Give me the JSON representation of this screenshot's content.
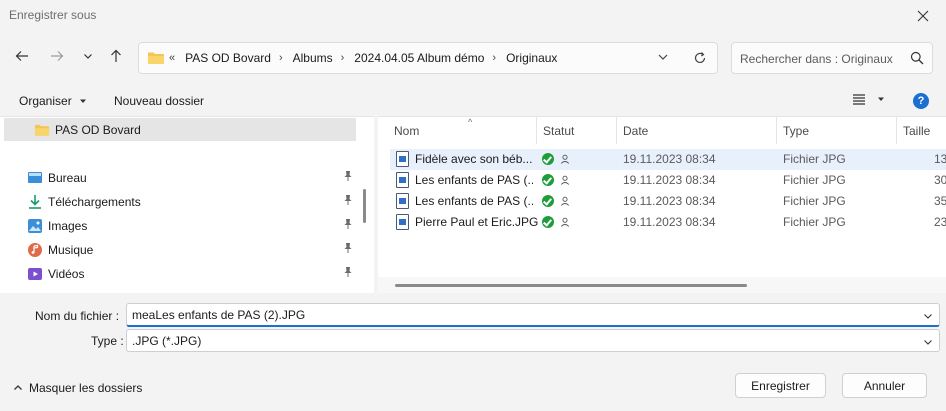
{
  "window": {
    "title": "Enregistrer sous"
  },
  "address": {
    "overflow": "«",
    "segments": [
      "PAS OD Bovard",
      "Albums",
      "2024.04.05 Album démo",
      "Originaux"
    ]
  },
  "search": {
    "placeholder": "Rechercher dans : Originaux"
  },
  "toolbar": {
    "organize_label": "Organiser",
    "new_folder_label": "Nouveau dossier",
    "help_label": "?"
  },
  "nav_pane": {
    "selected_label": "PAS OD Bovard",
    "items": [
      {
        "label": "Bureau",
        "icon": "desktop-icon",
        "color": "#3a8fd8"
      },
      {
        "label": "Téléchargements",
        "icon": "download-icon",
        "color": "#1b9b6b"
      },
      {
        "label": "Images",
        "icon": "pictures-icon",
        "color": "#3a8fd8"
      },
      {
        "label": "Musique",
        "icon": "music-icon",
        "color": "#e06a4a"
      },
      {
        "label": "Vidéos",
        "icon": "videos-icon",
        "color": "#7a4fd0"
      }
    ]
  },
  "file_list": {
    "columns": [
      "Nom",
      "Statut",
      "Date",
      "Type",
      "Taille"
    ],
    "rows": [
      {
        "name": "Fidèle avec son béb...",
        "date": "19.11.2023 08:34",
        "type": "Fichier JPG",
        "size": "13"
      },
      {
        "name": "Les enfants de PAS (...",
        "date": "19.11.2023 08:34",
        "type": "Fichier JPG",
        "size": "30"
      },
      {
        "name": "Les enfants de PAS (...",
        "date": "19.11.2023 08:34",
        "type": "Fichier JPG",
        "size": "35"
      },
      {
        "name": "Pierre Paul et Eric.JPG",
        "date": "19.11.2023 08:34",
        "type": "Fichier JPG",
        "size": "23"
      }
    ]
  },
  "form": {
    "filename_label": "Nom du fichier :",
    "filename_value": "meaLes enfants de PAS (2).JPG",
    "type_label": "Type :",
    "type_value": ".JPG (*.JPG)"
  },
  "footer": {
    "hide_folders_label": "Masquer les dossiers",
    "save_label": "Enregistrer",
    "cancel_label": "Annuler"
  },
  "colors": {
    "accent": "#1a6fd1",
    "folder": "#f5c451",
    "ok_green": "#1f9d3a"
  }
}
